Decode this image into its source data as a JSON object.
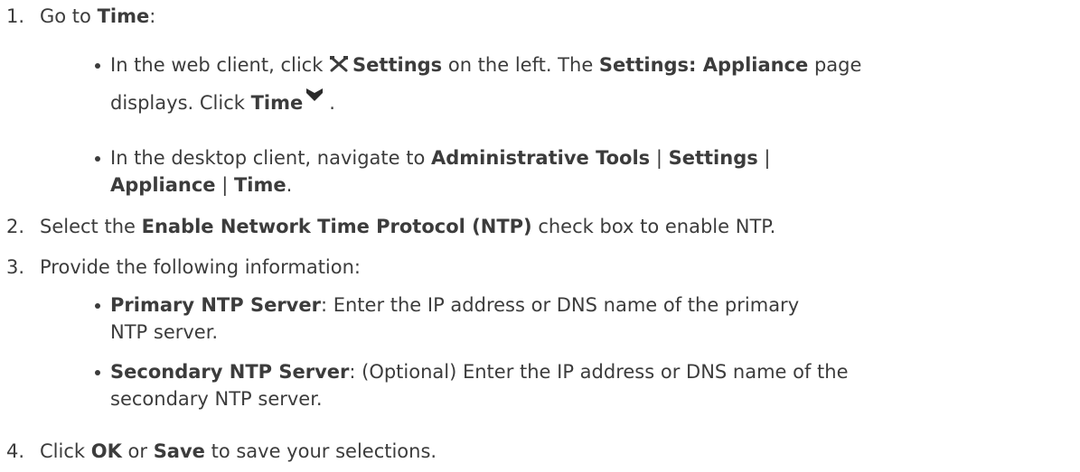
{
  "steps": [
    {
      "number": "1.",
      "parts": [
        "Go to ",
        "Time",
        ":"
      ],
      "bullets": [
        {
          "line1": [
            "In the web client, click ",
            "Settings",
            " on the left. The ",
            "Settings: Appliance",
            " page"
          ],
          "line2": [
            "displays. Click ",
            "Time",
            "."
          ],
          "icons": [
            "settings-tools-icon",
            "chevron-down-icon"
          ]
        },
        {
          "line1": [
            "In the desktop client, navigate to ",
            "Administrative Tools",
            " | ",
            "Settings",
            " |"
          ],
          "line2": [
            "Appliance",
            " | ",
            "Time",
            "."
          ]
        }
      ]
    },
    {
      "number": "2.",
      "parts": [
        "Select the ",
        "Enable Network Time Protocol (NTP)",
        " check box to enable NTP."
      ]
    },
    {
      "number": "3.",
      "parts": [
        "Provide the following information:"
      ],
      "bullets": [
        {
          "line1": [
            "Primary NTP Server",
            ": Enter the IP address or DNS name of the primary"
          ],
          "line2": [
            "NTP  server."
          ]
        },
        {
          "line1": [
            "Secondary NTP Server",
            ": (Optional) Enter the IP address or DNS name of the"
          ],
          "line2": [
            "secondary NTP server."
          ]
        }
      ]
    },
    {
      "number": "4.",
      "parts": [
        "Click ",
        "OK",
        " or ",
        "Save",
        " to save your selections."
      ]
    }
  ]
}
